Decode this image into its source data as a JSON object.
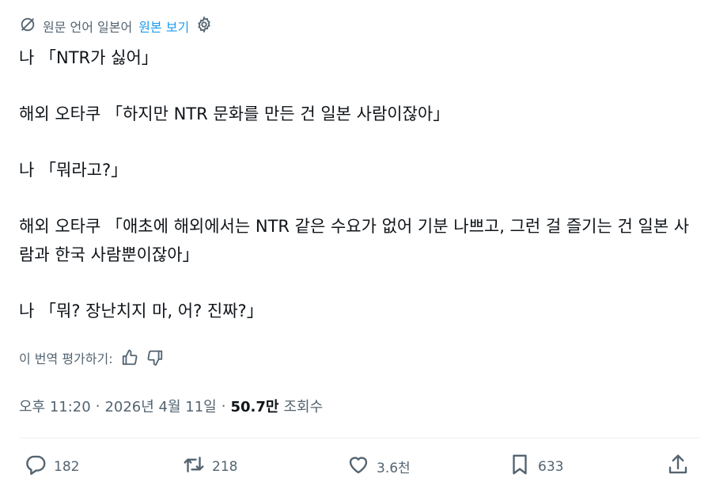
{
  "translate_bar": {
    "label": "원문 언어 일본어",
    "show_original": "원본 보기"
  },
  "tweet": {
    "lines": [
      "나 「NTR가 싫어」",
      "해외 오타쿠 「하지만 NTR 문화를 만든 건 일본 사람이잖아」",
      "나 「뭐라고?」",
      "해외 오타쿠 「애초에 해외에서는 NTR 같은 수요가 없어 기분 나쁘고, 그런 걸 즐기는 건 일본 사람과 한국 사람뿐이잖아」",
      "나 「뭐? 장난치지 마, 어? 진짜?」"
    ]
  },
  "rate": {
    "label": "이 번역 평가하기:"
  },
  "meta": {
    "time": "오후 11:20",
    "sep1": "·",
    "date": "2026년 4월 11일",
    "sep2": "·",
    "views_count": "50.7만",
    "views_label": "조회수"
  },
  "actions": {
    "replies": "182",
    "reposts": "218",
    "likes": "3.6천",
    "bookmarks": "633"
  },
  "colors": {
    "accent": "#1d9bf0",
    "secondary_text": "#536471",
    "primary_text": "#0f1419"
  }
}
